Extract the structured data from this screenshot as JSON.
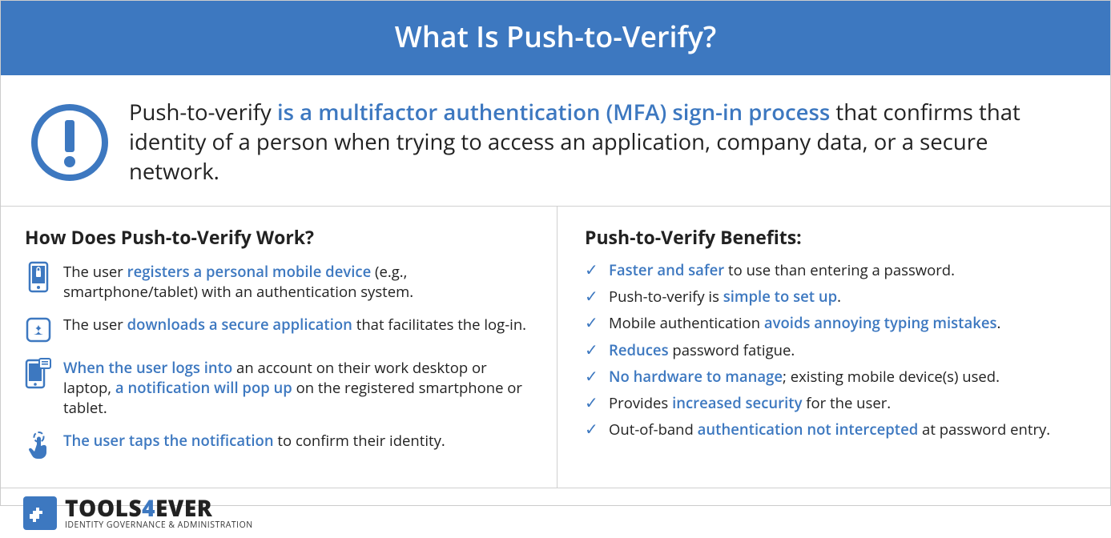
{
  "header": {
    "title": "What Is Push-to-Verify?"
  },
  "intro": {
    "pre": "Push-to-verify ",
    "highlight": "is a multifactor authentication (MFA) sign-in process",
    "post": " that confirms that identity of a person when trying to access an application, company data, or a secure network."
  },
  "how": {
    "heading": "How Does Push-to-Verify Work?",
    "steps": [
      {
        "icon": "device-register-icon",
        "parts": [
          {
            "t": "The user ",
            "hl": false
          },
          {
            "t": "registers a personal mobile device",
            "hl": true
          },
          {
            "t": " (e.g., smartphone/tablet) with an authentication system.",
            "hl": false
          }
        ]
      },
      {
        "icon": "app-download-icon",
        "parts": [
          {
            "t": "The user ",
            "hl": false
          },
          {
            "t": "downloads a secure application",
            "hl": true
          },
          {
            "t": " that facilitates the log-in.",
            "hl": false
          }
        ]
      },
      {
        "icon": "notification-popup-icon",
        "parts": [
          {
            "t": "When the user logs into",
            "hl": true
          },
          {
            "t": " an account on their work desktop or laptop, ",
            "hl": false
          },
          {
            "t": "a notification will pop up",
            "hl": true
          },
          {
            "t": " on the registered smartphone or tablet.",
            "hl": false
          }
        ]
      },
      {
        "icon": "tap-confirm-icon",
        "parts": [
          {
            "t": "The user taps the notification",
            "hl": true
          },
          {
            "t": " to confirm their identity.",
            "hl": false
          }
        ]
      }
    ]
  },
  "benefits": {
    "heading": "Push-to-Verify Benefits:",
    "items": [
      [
        {
          "t": "Faster and safer",
          "hl": true
        },
        {
          "t": " to use than entering a password.",
          "hl": false
        }
      ],
      [
        {
          "t": "Push-to-verify is ",
          "hl": false
        },
        {
          "t": "simple to set up",
          "hl": true
        },
        {
          "t": ".",
          "hl": false
        }
      ],
      [
        {
          "t": "Mobile authentication ",
          "hl": false
        },
        {
          "t": "avoids annoying typing mistakes",
          "hl": true
        },
        {
          "t": ".",
          "hl": false
        }
      ],
      [
        {
          "t": "Reduces",
          "hl": true
        },
        {
          "t": " password fatigue.",
          "hl": false
        }
      ],
      [
        {
          "t": "No hardware to manage",
          "hl": true
        },
        {
          "t": "; existing mobile device(s) used.",
          "hl": false
        }
      ],
      [
        {
          "t": "Provides ",
          "hl": false
        },
        {
          "t": "increased security",
          "hl": true
        },
        {
          "t": " for the user.",
          "hl": false
        }
      ],
      [
        {
          "t": "Out-of-band ",
          "hl": false
        },
        {
          "t": "authentication not intercepted",
          "hl": true
        },
        {
          "t": " at password entry.",
          "hl": false
        }
      ]
    ]
  },
  "footer": {
    "brand_pre": "TOOLS",
    "brand_four": "4",
    "brand_post": "EVER",
    "tagline": "IDENTITY GOVERNANCE & ADMINISTRATION"
  }
}
